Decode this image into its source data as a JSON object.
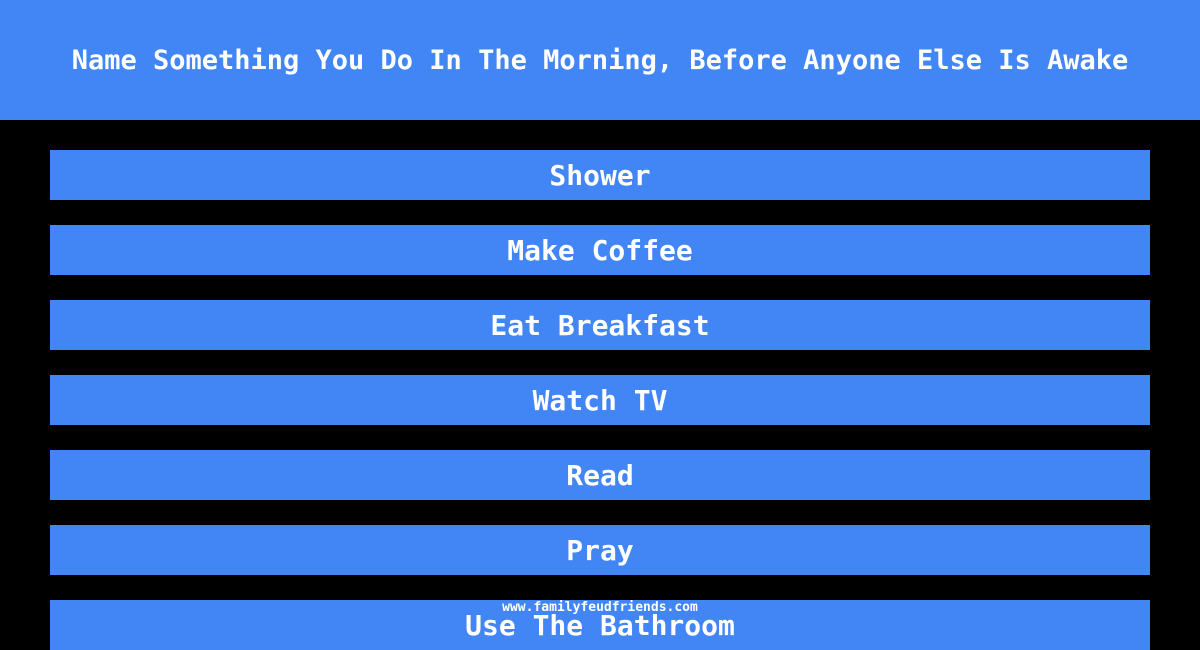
{
  "header": {
    "title": "Name Something You Do In The Morning, Before Anyone Else Is Awake"
  },
  "answers": [
    {
      "label": "Shower"
    },
    {
      "label": "Make Coffee"
    },
    {
      "label": "Eat Breakfast"
    },
    {
      "label": "Watch TV"
    },
    {
      "label": "Read"
    },
    {
      "label": "Pray"
    },
    {
      "label": "Use The Bathroom"
    }
  ],
  "footer": {
    "watermark": "www.familyfeudfriends.com"
  },
  "colors": {
    "accent": "#4285f4",
    "background": "#000000",
    "text": "#ffffff"
  }
}
